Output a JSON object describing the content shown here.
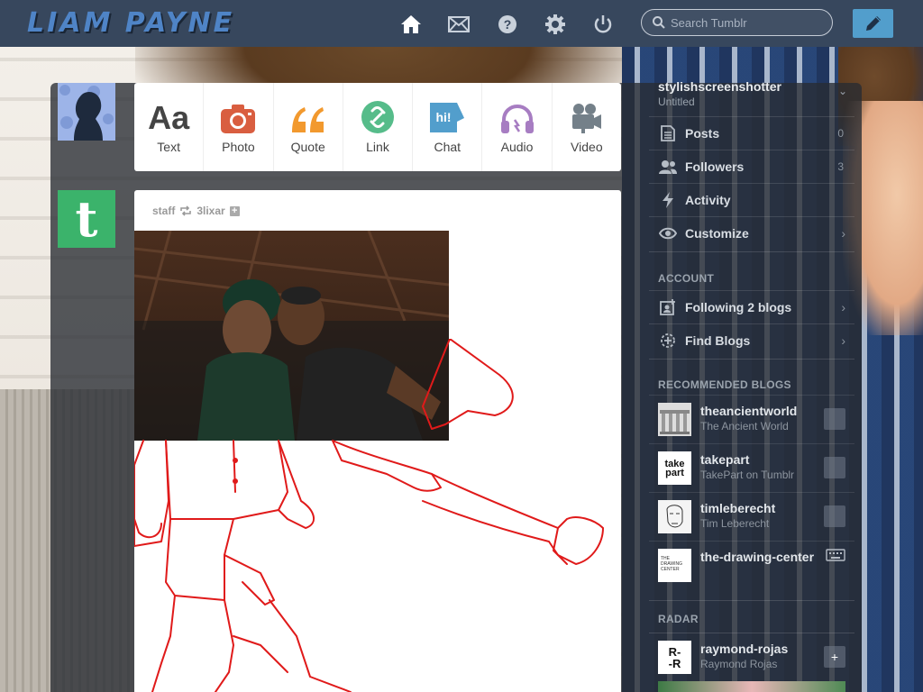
{
  "header": {
    "blog_title": "LIAM PAYNE",
    "search_placeholder": "Search Tumblr",
    "nav_icons": [
      "home-icon",
      "mail-icon",
      "help-icon",
      "gear-icon",
      "power-icon"
    ],
    "compose_icon": "pencil-icon"
  },
  "post_types": [
    {
      "label": "Text",
      "glyph": "Aa",
      "color": "#444444"
    },
    {
      "label": "Photo",
      "color": "#d95e40"
    },
    {
      "label": "Quote",
      "glyph": "66",
      "color": "#f2992e"
    },
    {
      "label": "Link",
      "color": "#56bc8a"
    },
    {
      "label": "Chat",
      "glyph": "hi!",
      "color": "#529ecc"
    },
    {
      "label": "Audio",
      "color": "#a77dc2"
    },
    {
      "label": "Video",
      "color": "#748089"
    }
  ],
  "post": {
    "author": "staff",
    "reblogged_from": "3lixar"
  },
  "sidebar": {
    "account_name": "stylishscreenshotter",
    "account_subtitle": "Untitled",
    "items": [
      {
        "label": "Posts",
        "count": "0",
        "icon": "posts-icon"
      },
      {
        "label": "Followers",
        "count": "3",
        "icon": "followers-icon"
      },
      {
        "label": "Activity",
        "icon": "activity-icon"
      },
      {
        "label": "Customize",
        "icon": "eye-icon"
      }
    ],
    "account_section": "ACCOUNT",
    "account_items": [
      {
        "label": "Following 2 blogs",
        "icon": "following-icon"
      },
      {
        "label": "Find Blogs",
        "icon": "find-blogs-icon"
      }
    ],
    "recommended_section": "RECOMMENDED BLOGS",
    "recommended": [
      {
        "name": "theancientworld",
        "title": "The Ancient World"
      },
      {
        "name": "takepart",
        "title": "TakePart on Tumblr"
      },
      {
        "name": "timleberecht",
        "title": "Tim Leberecht"
      },
      {
        "name": "the-drawing-center",
        "title": ""
      }
    ],
    "radar_section": "RADAR",
    "radar": {
      "name": "raymond-rojas",
      "title": "Raymond Rojas",
      "thumb_text": "R-\n-R"
    }
  }
}
